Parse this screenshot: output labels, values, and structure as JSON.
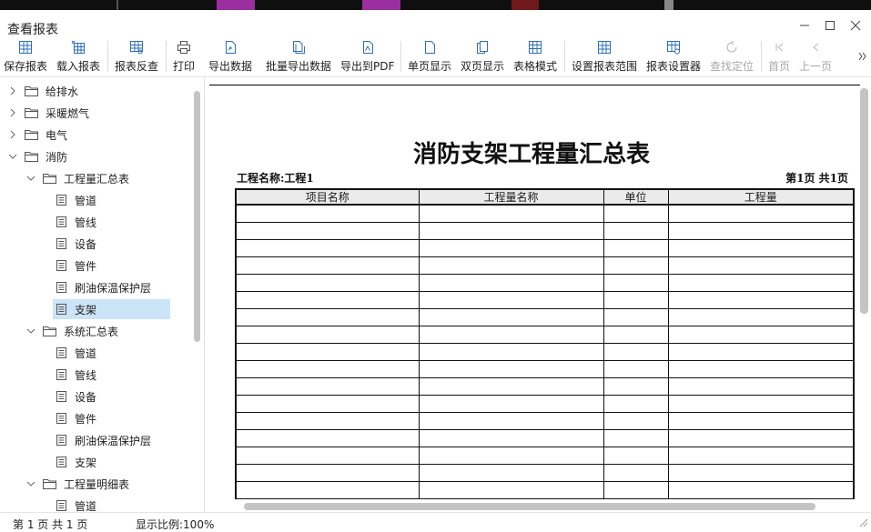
{
  "window": {
    "title": "查看报表"
  },
  "colors": {
    "accent": "#cce4f7",
    "splitter": "#7fc276",
    "icon_blue": "#2e6fb7"
  },
  "toolbar": {
    "buttons": [
      {
        "label": "保存报表",
        "icon": "save-report-icon",
        "enabled": true
      },
      {
        "label": "载入报表",
        "icon": "load-report-icon",
        "enabled": true
      },
      {
        "label": "报表反查",
        "icon": "reverse-lookup-icon",
        "enabled": true
      },
      {
        "label": "打印",
        "icon": "print-icon",
        "enabled": true
      },
      {
        "label": "导出数据",
        "icon": "export-data-icon",
        "enabled": true
      },
      {
        "label": "批量导出数据",
        "icon": "batch-export-icon",
        "enabled": true
      },
      {
        "label": "导出到PDF",
        "icon": "export-pdf-icon",
        "enabled": true
      },
      {
        "label": "单页显示",
        "icon": "single-page-icon",
        "enabled": true
      },
      {
        "label": "双页显示",
        "icon": "double-page-icon",
        "enabled": true
      },
      {
        "label": "表格模式",
        "icon": "table-mode-icon",
        "enabled": true
      },
      {
        "label": "设置报表范围",
        "icon": "report-range-icon",
        "enabled": true
      },
      {
        "label": "报表设置器",
        "icon": "report-settings-icon",
        "enabled": true
      },
      {
        "label": "查找定位",
        "icon": "find-locate-icon",
        "enabled": false
      },
      {
        "label": "首页",
        "icon": "first-page-icon",
        "enabled": false
      },
      {
        "label": "上一页",
        "icon": "prev-page-icon",
        "enabled": false
      }
    ]
  },
  "tree": {
    "items": [
      {
        "label": "给排水",
        "level": 0,
        "type": "folder",
        "expanded": false
      },
      {
        "label": "采暖燃气",
        "level": 0,
        "type": "folder",
        "expanded": false
      },
      {
        "label": "电气",
        "level": 0,
        "type": "folder",
        "expanded": false
      },
      {
        "label": "消防",
        "level": 0,
        "type": "folder",
        "expanded": true
      },
      {
        "label": "工程量汇总表",
        "level": 1,
        "type": "folder",
        "expanded": true
      },
      {
        "label": "管道",
        "level": 2,
        "type": "doc"
      },
      {
        "label": "管线",
        "level": 2,
        "type": "doc"
      },
      {
        "label": "设备",
        "level": 2,
        "type": "doc"
      },
      {
        "label": "管件",
        "level": 2,
        "type": "doc"
      },
      {
        "label": "刷油保温保护层",
        "level": 2,
        "type": "doc"
      },
      {
        "label": "支架",
        "level": 2,
        "type": "doc",
        "selected": true
      },
      {
        "label": "系统汇总表",
        "level": 1,
        "type": "folder",
        "expanded": true
      },
      {
        "label": "管道",
        "level": 2,
        "type": "doc"
      },
      {
        "label": "管线",
        "level": 2,
        "type": "doc"
      },
      {
        "label": "设备",
        "level": 2,
        "type": "doc"
      },
      {
        "label": "管件",
        "level": 2,
        "type": "doc"
      },
      {
        "label": "刷油保温保护层",
        "level": 2,
        "type": "doc"
      },
      {
        "label": "支架",
        "level": 2,
        "type": "doc"
      },
      {
        "label": "工程量明细表",
        "level": 1,
        "type": "folder",
        "expanded": true
      },
      {
        "label": "管道",
        "level": 2,
        "type": "doc"
      }
    ]
  },
  "report": {
    "title": "消防支架工程量汇总表",
    "project_label": "工程名称:工程1",
    "page_info": "第1页 共1页",
    "columns": [
      "项目名称",
      "工程量名称",
      "单位",
      "工程量"
    ],
    "empty_rows": 17
  },
  "status": {
    "page_text": "第 1 页  共 1 页",
    "zoom_label": "显示比例:",
    "zoom_value": "100%"
  }
}
